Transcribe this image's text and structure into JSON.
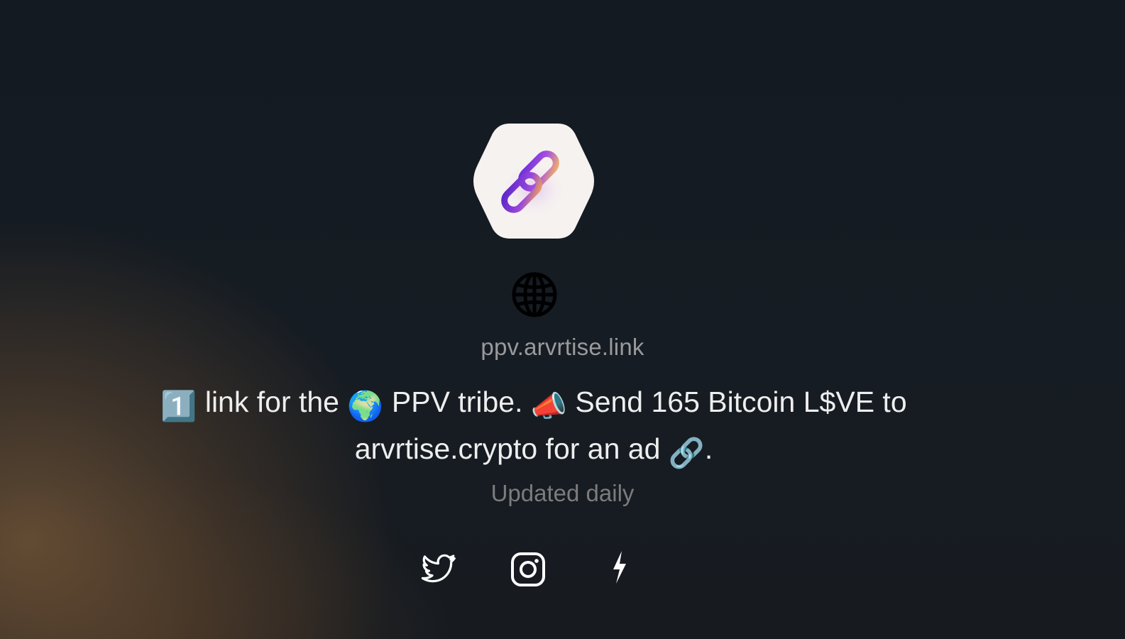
{
  "profile": {
    "avatar_icon": "link-chain-icon",
    "site_icon": "globe-icon",
    "domain": "ppv.arvrtise.link",
    "bio": {
      "badge_emoji": "1️⃣",
      "part1": "link for the",
      "globe_emoji": "🌍",
      "part2": "PPV tribe.",
      "megaphone_emoji": "📣",
      "part3": "Send 165 Bitcoin L$VE to",
      "part4": "arvrtise.crypto for an ad",
      "link_emoji": "🔗",
      "part5": "."
    },
    "subtitle": "Updated daily"
  },
  "socials": [
    {
      "name": "twitter",
      "icon": "twitter-icon"
    },
    {
      "name": "instagram",
      "icon": "instagram-icon"
    },
    {
      "name": "lightning",
      "icon": "lightning-icon"
    }
  ],
  "colors": {
    "background": "#141a21",
    "glow": "#7d5c3a",
    "avatar_bg": "#f6f2f0",
    "text": "#eeeeee",
    "muted": "#9a9a9c"
  }
}
